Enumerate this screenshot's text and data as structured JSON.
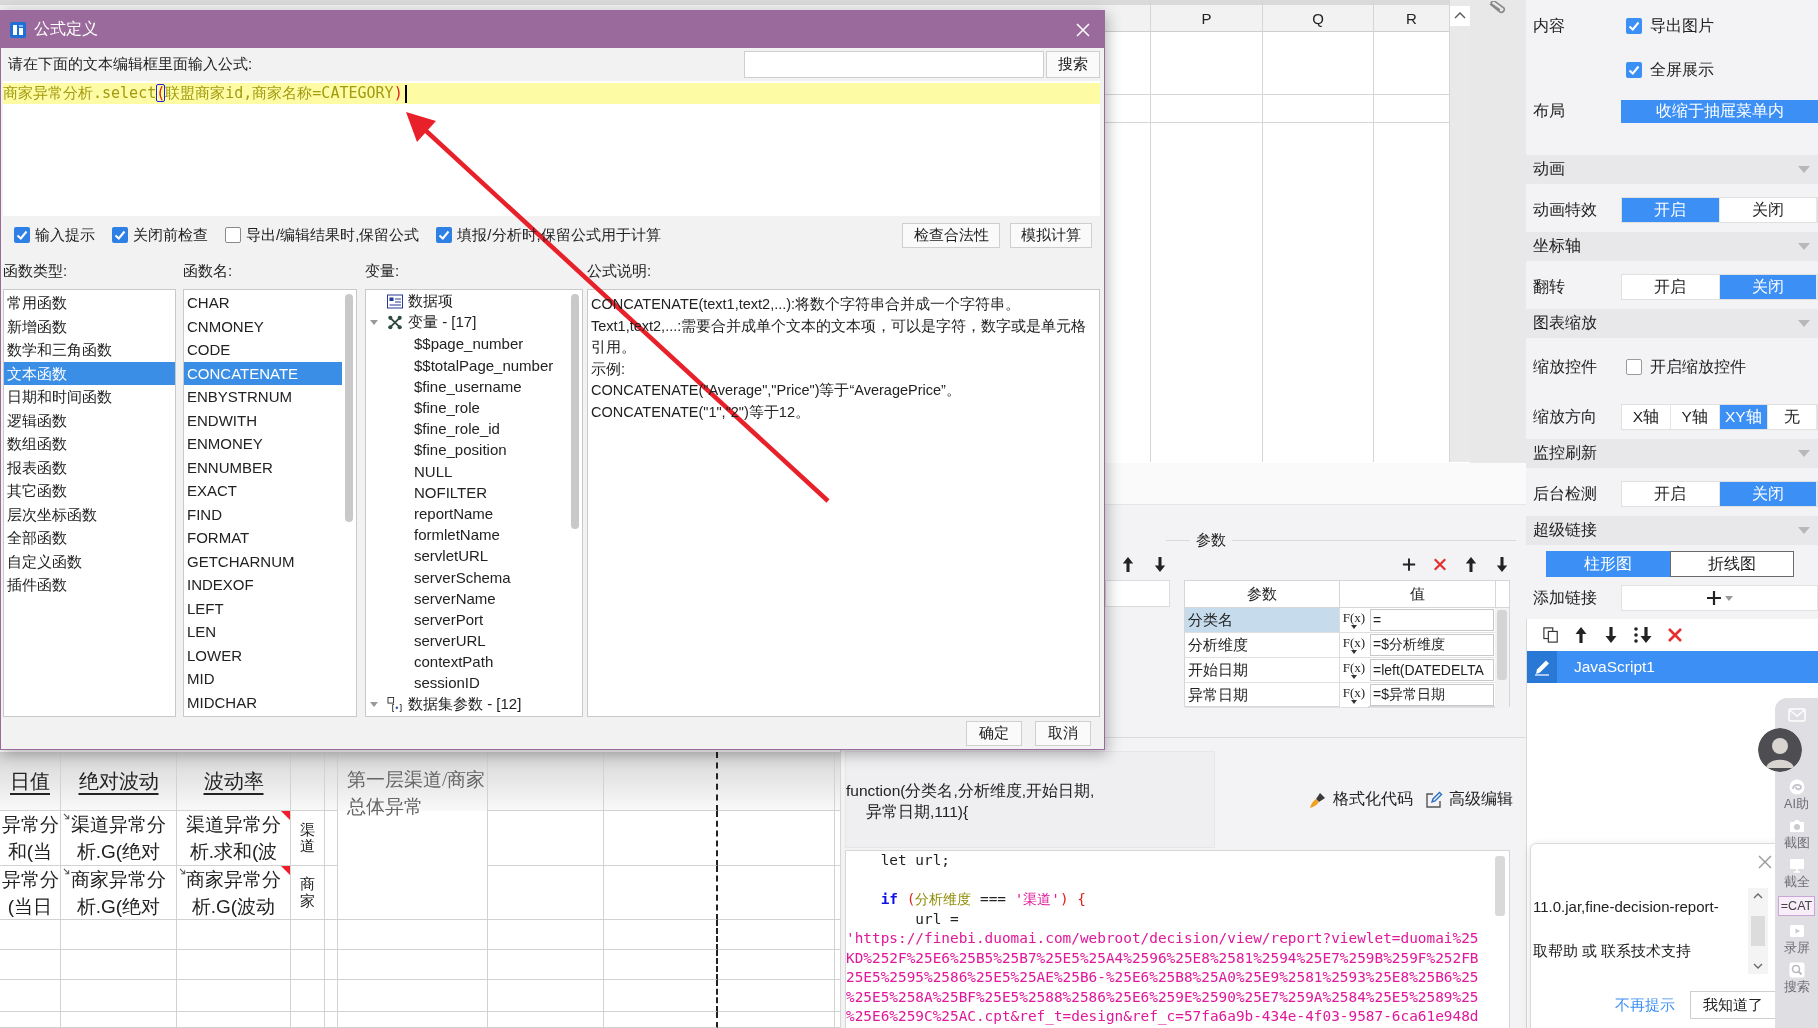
{
  "spreadsheet": {
    "columns": [
      "P",
      "Q",
      "R"
    ]
  },
  "report": {
    "headers": [
      "日值",
      "绝对波动",
      "波动率"
    ],
    "rows": [
      {
        "cells": [
          {
            "text": "异常分和(当",
            "expand": false,
            "flagged": false
          },
          {
            "text": "渠道异常分析.G(绝对",
            "expand": true,
            "flagged": false
          },
          {
            "text": "渠道异常分析.求和(波",
            "expand": false,
            "flagged": true
          }
        ],
        "tag": "渠道"
      },
      {
        "cells": [
          {
            "text": "异常分(当日",
            "expand": false,
            "flagged": false
          },
          {
            "text": "商家异常分析.G(绝对",
            "expand": true,
            "flagged": false
          },
          {
            "text": "商家异常分析.G(波动",
            "expand": true,
            "flagged": true
          }
        ],
        "tag": "商家"
      }
    ],
    "note": "第一层渠道/商家总体异常"
  },
  "formula_dialog": {
    "title": "公式定义",
    "prompt": "请在下面的文本编辑框里面输入公式:",
    "search_button": "搜索",
    "formula": [
      {
        "text": "商家异常分析.select",
        "kind": "text",
        "matched": false
      },
      {
        "text": "(",
        "kind": "bracket",
        "matched": true
      },
      {
        "text": "联盟商家id,商家名称=CATEGORY",
        "kind": "text",
        "matched": false
      },
      {
        "text": ")",
        "kind": "bracket",
        "matched": false
      }
    ],
    "options": [
      {
        "label": "输入提示",
        "checked": true
      },
      {
        "label": "关闭前检查",
        "checked": true
      },
      {
        "label": "导出/编辑结果时,保留公式",
        "checked": false
      },
      {
        "label": "填报/分析时,保留公式用于计算",
        "checked": true
      }
    ],
    "actions": [
      "检查合法性",
      "模拟计算"
    ],
    "function_types": {
      "label": "函数类型:",
      "items": [
        {
          "label": "常用函数",
          "selected": false
        },
        {
          "label": "新增函数",
          "selected": false
        },
        {
          "label": "数学和三角函数",
          "selected": false
        },
        {
          "label": "文本函数",
          "selected": true
        },
        {
          "label": "日期和时间函数",
          "selected": false
        },
        {
          "label": "逻辑函数",
          "selected": false
        },
        {
          "label": "数组函数",
          "selected": false
        },
        {
          "label": "报表函数",
          "selected": false
        },
        {
          "label": "其它函数",
          "selected": false
        },
        {
          "label": "层次坐标函数",
          "selected": false
        },
        {
          "label": "全部函数",
          "selected": false
        },
        {
          "label": "自定义函数",
          "selected": false
        },
        {
          "label": "插件函数",
          "selected": false
        }
      ]
    },
    "function_names": {
      "label": "函数名:",
      "items": [
        {
          "label": "CHAR",
          "selected": false
        },
        {
          "label": "CNMONEY",
          "selected": false
        },
        {
          "label": "CODE",
          "selected": false
        },
        {
          "label": "CONCATENATE",
          "selected": true
        },
        {
          "label": "ENBYSTRNUM",
          "selected": false
        },
        {
          "label": "ENDWITH",
          "selected": false
        },
        {
          "label": "ENMONEY",
          "selected": false
        },
        {
          "label": "ENNUMBER",
          "selected": false
        },
        {
          "label": "EXACT",
          "selected": false
        },
        {
          "label": "FIND",
          "selected": false
        },
        {
          "label": "FORMAT",
          "selected": false
        },
        {
          "label": "GETCHARNUM",
          "selected": false
        },
        {
          "label": "INDEXOF",
          "selected": false
        },
        {
          "label": "LEFT",
          "selected": false
        },
        {
          "label": "LEN",
          "selected": false
        },
        {
          "label": "LOWER",
          "selected": false
        },
        {
          "label": "MID",
          "selected": false
        },
        {
          "label": "MIDCHAR",
          "selected": false
        }
      ]
    },
    "variables": {
      "label": "变量:",
      "nodes": [
        {
          "label": "数据项",
          "kind": "data"
        },
        {
          "label": "变量 - [17]",
          "kind": "variable",
          "expanded": true,
          "children": [
            {
              "label": "$$page_number"
            },
            {
              "label": "$$totalPage_number"
            },
            {
              "label": "$fine_username"
            },
            {
              "label": "$fine_role"
            },
            {
              "label": "$fine_role_id"
            },
            {
              "label": "$fine_position"
            },
            {
              "label": "NULL"
            },
            {
              "label": "NOFILTER"
            },
            {
              "label": "reportName"
            },
            {
              "label": "formletName"
            },
            {
              "label": "servletURL"
            },
            {
              "label": "serverSchema"
            },
            {
              "label": "serverName"
            },
            {
              "label": "serverPort"
            },
            {
              "label": "serverURL"
            },
            {
              "label": "contextPath"
            },
            {
              "label": "sessionID"
            }
          ]
        },
        {
          "label": "数据集参数 - [12]",
          "kind": "dataset",
          "expanded": true
        }
      ]
    },
    "description": {
      "label": "公式说明:",
      "lines": [
        "CONCATENATE(text1,text2,...):将数个字符串合并成一个字符串。",
        "Text1,text2,...:需要合并成单个文本的文本项，可以是字符，数字或是单元格引用。",
        "示例:",
        "CONCATENATE(\"Average\",\"Price\")等于“AveragePrice”。",
        "CONCATENATE(\"1\",\"2\")等于12。"
      ]
    },
    "buttons": [
      "确定",
      "取消"
    ]
  },
  "hyperlink_editor": {
    "params_label": "参数",
    "params": {
      "columns": [
        "参数",
        "值"
      ],
      "rows": [
        {
          "name": "分类名",
          "fx": "F(x)",
          "value": "=",
          "selected": true
        },
        {
          "name": "分析维度",
          "fx": "F(x)",
          "value": "=$分析维度",
          "selected": false
        },
        {
          "name": "开始日期",
          "fx": "F(x)",
          "value": "=left(DATEDELTA",
          "selected": false
        },
        {
          "name": "异常日期",
          "fx": "F(x)",
          "value": "=$异常日期",
          "selected": false
        }
      ]
    },
    "signature": [
      "function(分类名,分析维度,开始日期,",
      "异常日期,111){"
    ],
    "tools": [
      {
        "label": "格式化代码",
        "kind": "format"
      },
      {
        "label": "高级编辑",
        "kind": "edit"
      }
    ],
    "code": [
      {
        "kind": "code",
        "tokens": [
          {
            "text": "    let url;",
            "kind": "plain"
          }
        ]
      },
      {
        "kind": "blank"
      },
      {
        "kind": "code",
        "tokens": [
          {
            "text": "    if",
            "kind": "keyword"
          },
          {
            "text": " (",
            "kind": "bracket"
          },
          {
            "text": "分析维度",
            "kind": "variable"
          },
          {
            "text": " === ",
            "kind": "plain"
          },
          {
            "text": "'渠道'",
            "kind": "string"
          },
          {
            "text": ")",
            "kind": "bracket"
          },
          {
            "text": " {",
            "kind": "bracket"
          }
        ]
      },
      {
        "kind": "code",
        "tokens": [
          {
            "text": "        url =",
            "kind": "plain"
          }
        ]
      },
      {
        "kind": "code",
        "tokens": [
          {
            "text": "'https://finebi.duomai.com/webroot/decision/view/report?viewlet=duomai%25",
            "kind": "string"
          }
        ]
      },
      {
        "kind": "code",
        "tokens": [
          {
            "text": "KD%252F%25E6%25B5%25B7%25E5%25A4%2596%25E8%2581%2594%25E7%259B%259F%252FB",
            "kind": "string"
          }
        ]
      },
      {
        "kind": "code",
        "tokens": [
          {
            "text": "25E5%2595%2586%25E5%25AE%25B6-%25E6%25B8%25A0%25E9%2581%2593%25E8%25B6%25",
            "kind": "string"
          }
        ]
      },
      {
        "kind": "code",
        "tokens": [
          {
            "text": "%25E5%258A%25BF%25E5%2588%2586%25E6%259E%2590%25E7%259A%2584%25E5%2589%25",
            "kind": "string"
          }
        ]
      },
      {
        "kind": "code",
        "tokens": [
          {
            "text": "%25E6%259C%25AC.cpt&ref_t=design&ref_c=57fa6a9b-434e-4f03-9587-6ca61e948d",
            "kind": "string"
          }
        ]
      }
    ]
  },
  "properties": {
    "rows": [
      {
        "kind": "checks",
        "label": "内容",
        "options": [
          {
            "label": "导出图片",
            "checked": true
          },
          {
            "label": "全屏展示",
            "checked": true
          }
        ]
      },
      {
        "kind": "button",
        "label": "布局",
        "value": "收缩于抽屉菜单内"
      },
      {
        "kind": "section",
        "label": "动画",
        "expanded": true
      },
      {
        "kind": "segmented",
        "label": "动画特效",
        "options": [
          {
            "label": "开启",
            "selected": true
          },
          {
            "label": "关闭",
            "selected": false
          }
        ]
      },
      {
        "kind": "section",
        "label": "坐标轴",
        "expanded": true
      },
      {
        "kind": "segmented",
        "label": "翻转",
        "options": [
          {
            "label": "开启",
            "selected": false
          },
          {
            "label": "关闭",
            "selected": true
          }
        ]
      },
      {
        "kind": "section",
        "label": "图表缩放",
        "expanded": true
      },
      {
        "kind": "checks",
        "label": "缩放控件",
        "options": [
          {
            "label": "开启缩放控件",
            "checked": false
          }
        ]
      },
      {
        "kind": "segmented",
        "label": "缩放方向",
        "options": [
          {
            "label": "X轴",
            "selected": false
          },
          {
            "label": "Y轴",
            "selected": false
          },
          {
            "label": "XY轴",
            "selected": true
          },
          {
            "label": "无",
            "selected": false
          }
        ]
      },
      {
        "kind": "section",
        "label": "监控刷新",
        "expanded": true
      },
      {
        "kind": "segmented",
        "label": "后台检测",
        "options": [
          {
            "label": "开启",
            "selected": false
          },
          {
            "label": "关闭",
            "selected": true
          }
        ]
      },
      {
        "kind": "section",
        "label": "超级链接",
        "expanded": true
      },
      {
        "kind": "tabs",
        "options": [
          {
            "label": "柱形图",
            "selected": true
          },
          {
            "label": "折线图",
            "selected": false
          }
        ]
      },
      {
        "kind": "links",
        "label": "添加链接",
        "items": [
          {
            "label": "JavaScript1",
            "selected": true
          }
        ]
      }
    ]
  },
  "notification": {
    "lines": [
      "11.0.jar,fine-decision-report-",
      "取帮助 或 联系技术支持"
    ],
    "link": "不再提示",
    "button": "我知道了"
  },
  "assistant_bar": {
    "items": [
      {
        "label": "AI助",
        "kind": "ai"
      },
      {
        "label": "截图",
        "kind": "camera"
      },
      {
        "label": "截全",
        "kind": "screen"
      },
      {
        "label": "=CAT",
        "kind": "chip"
      },
      {
        "label": "录屏",
        "kind": "video"
      },
      {
        "label": "搜索",
        "kind": "search"
      }
    ]
  }
}
